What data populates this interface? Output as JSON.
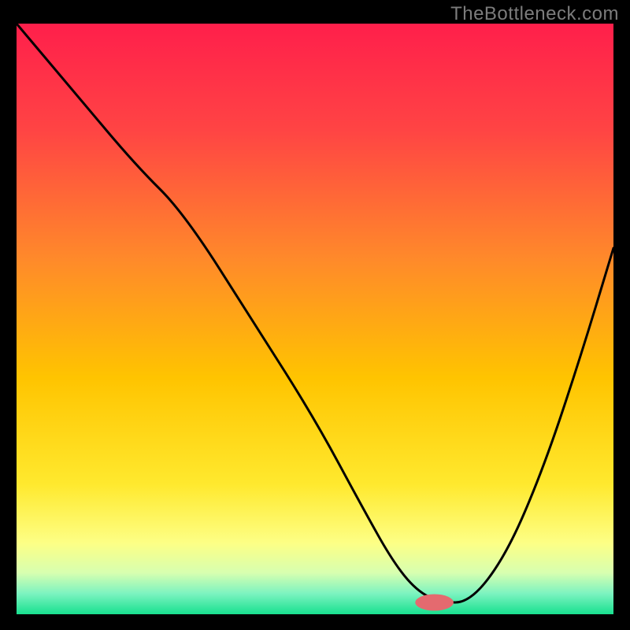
{
  "watermark": "TheBottleneck.com",
  "chart_data": {
    "type": "line",
    "title": "",
    "xlabel": "",
    "ylabel": "",
    "xlim": [
      0,
      100
    ],
    "ylim": [
      0,
      100
    ],
    "grid": false,
    "legend": false,
    "series": [
      {
        "name": "curve",
        "x": [
          0,
          10,
          20,
          28,
          40,
          50,
          58,
          63,
          67,
          71,
          76,
          82,
          88,
          94,
          100
        ],
        "y": [
          100,
          88,
          76,
          68,
          49,
          33,
          18,
          9,
          4,
          2,
          2,
          10,
          24,
          42,
          62
        ]
      }
    ],
    "marker": {
      "x": 70,
      "y": 2,
      "rx": 3.2,
      "ry": 1.4,
      "color": "#e46a6f"
    },
    "background_gradient": {
      "stops": [
        {
          "offset": 0.0,
          "color": "#ff1f4b"
        },
        {
          "offset": 0.18,
          "color": "#ff4444"
        },
        {
          "offset": 0.4,
          "color": "#ff8a2a"
        },
        {
          "offset": 0.6,
          "color": "#ffc400"
        },
        {
          "offset": 0.78,
          "color": "#ffe92e"
        },
        {
          "offset": 0.88,
          "color": "#fdff86"
        },
        {
          "offset": 0.93,
          "color": "#d7ffb0"
        },
        {
          "offset": 0.965,
          "color": "#7cf3c0"
        },
        {
          "offset": 1.0,
          "color": "#18e08f"
        }
      ]
    }
  }
}
